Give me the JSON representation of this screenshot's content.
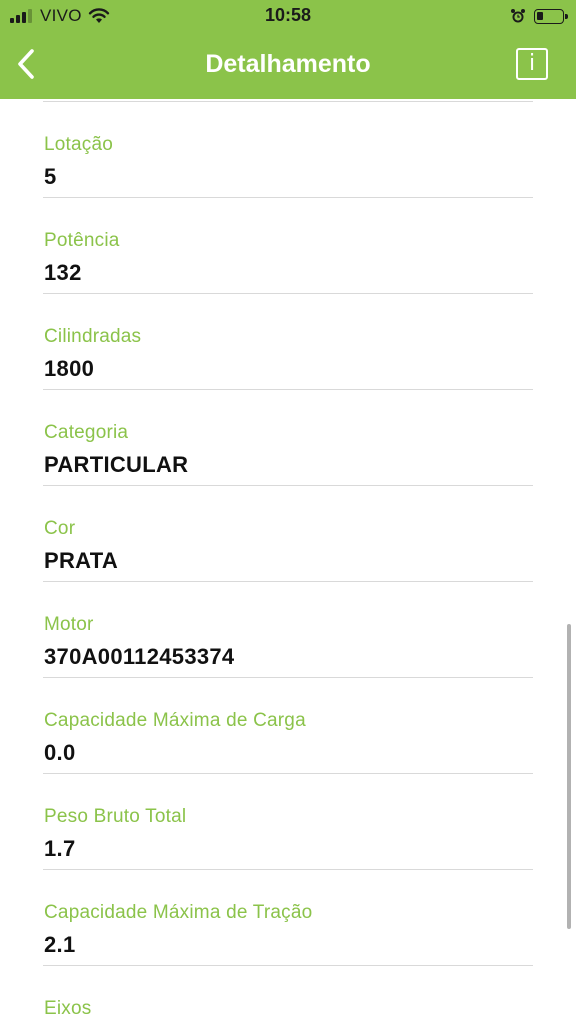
{
  "status_bar": {
    "carrier": "VIVO",
    "time": "10:58",
    "icons": [
      "signal-icon",
      "wifi-icon",
      "alarm-icon",
      "battery-icon"
    ]
  },
  "nav": {
    "title": "Detalhamento",
    "back_icon": "chevron-left-icon",
    "info_label": "i"
  },
  "theme": {
    "accent": "#8bc34a",
    "label_color": "#8bc34a",
    "value_color": "#111111",
    "divider": "#d9d9d9"
  },
  "fields": [
    {
      "label": "Lotação",
      "value": "5"
    },
    {
      "label": "Potência",
      "value": "132"
    },
    {
      "label": "Cilindradas",
      "value": "1800"
    },
    {
      "label": "Categoria",
      "value": "PARTICULAR"
    },
    {
      "label": "Cor",
      "value": "PRATA"
    },
    {
      "label": "Motor",
      "value": "370A00112453374"
    },
    {
      "label": "Capacidade Máxima de Carga",
      "value": "0.0"
    },
    {
      "label": "Peso Bruto Total",
      "value": "1.7"
    },
    {
      "label": "Capacidade Máxima de Tração",
      "value": "2.1"
    },
    {
      "label": "Eixos",
      "value": ""
    }
  ]
}
